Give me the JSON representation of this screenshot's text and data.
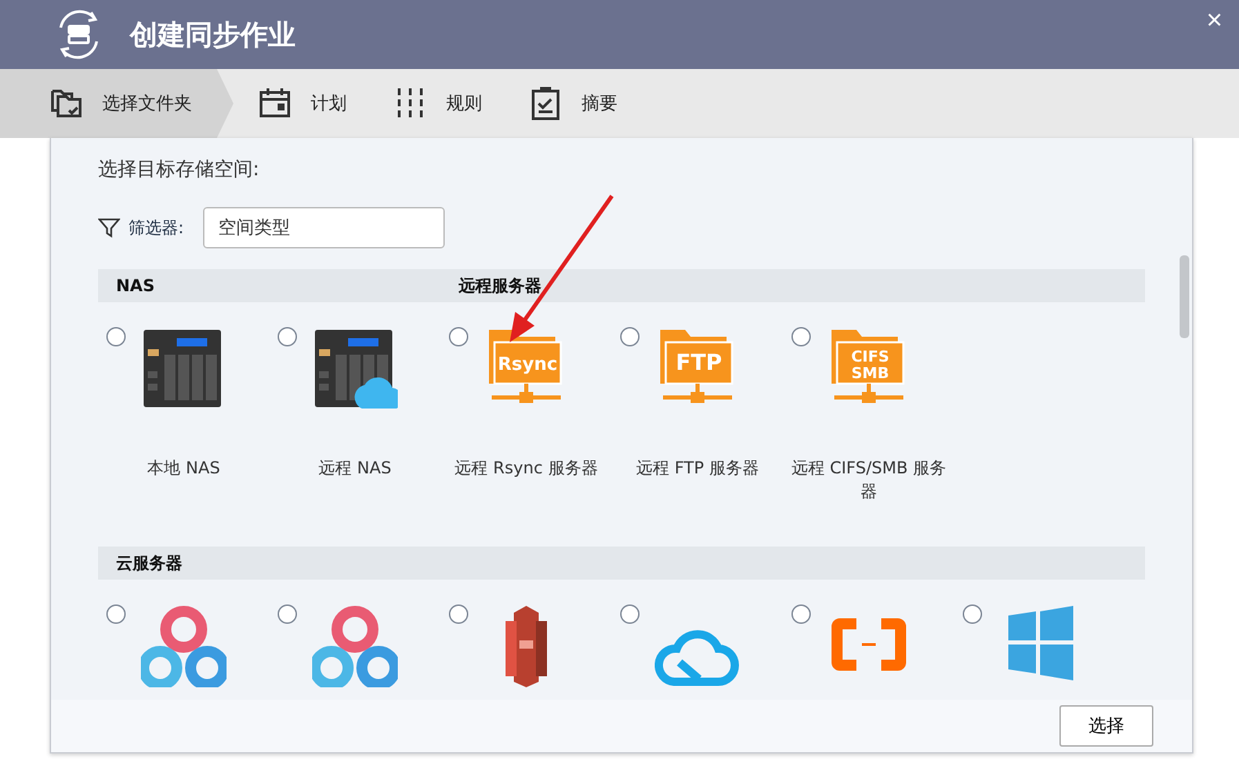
{
  "window": {
    "title": "创建同步作业",
    "close": "×"
  },
  "steps": [
    {
      "kind": "folder",
      "label": "选择文件夹",
      "selected": true
    },
    {
      "kind": "calendar",
      "label": "计划",
      "selected": false
    },
    {
      "kind": "rules",
      "label": "规则",
      "selected": false
    },
    {
      "kind": "summary",
      "label": "摘要",
      "selected": false
    }
  ],
  "prompt": "选择目标存储空间:",
  "filter": {
    "label": "筛选器:",
    "value": "空间类型"
  },
  "sections": [
    {
      "headers": [
        "NAS",
        "远程服务器"
      ],
      "items": [
        {
          "kind": "nas",
          "label": "本地 NAS",
          "selected": false
        },
        {
          "kind": "nas-cloud",
          "label": "远程 NAS",
          "selected": false
        },
        {
          "kind": "folder",
          "badge": [
            "Rsync"
          ],
          "label": "远程 Rsync 服务器",
          "selected": false
        },
        {
          "kind": "folder",
          "badge": [
            "FTP"
          ],
          "label": "远程 FTP 服务器",
          "selected": false
        },
        {
          "kind": "folder",
          "badge": [
            "CIFS",
            "SMB"
          ],
          "label": "远程 CIFS/SMB 服务器",
          "selected": false
        }
      ]
    },
    {
      "headers": [
        "云服务器"
      ],
      "items": [
        {
          "kind": "rings",
          "selected": false
        },
        {
          "kind": "rings",
          "selected": false
        },
        {
          "kind": "blocks",
          "selected": false
        },
        {
          "kind": "link-cloud",
          "selected": false
        },
        {
          "kind": "brackets",
          "selected": false
        },
        {
          "kind": "windows",
          "selected": false
        }
      ]
    }
  ],
  "buttons": [
    "选择"
  ]
}
